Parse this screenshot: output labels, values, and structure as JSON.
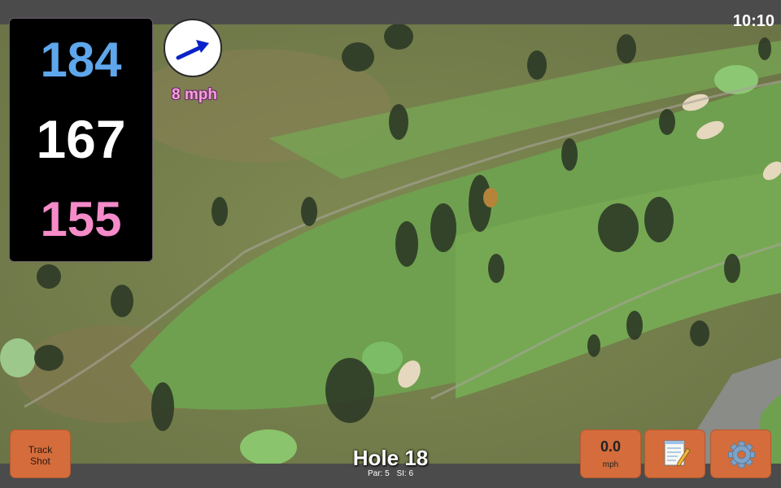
{
  "status": {
    "time": "10:10"
  },
  "distances": {
    "back": "184",
    "middle": "167",
    "front": "155"
  },
  "wind": {
    "speed_label": "8 mph",
    "direction_icon": "arrow-icon"
  },
  "buttons": {
    "track_shot_line1": "Track",
    "track_shot_line2": "Shot",
    "speed_value": "0.0",
    "speed_unit": "mph",
    "notes_icon": "notepad-icon",
    "settings_icon": "gear-icon"
  },
  "hole": {
    "title": "Hole 18",
    "par": "Par: 5",
    "si": "SI: 6"
  },
  "colors": {
    "back": "#5fa7ec",
    "middle": "#ffffff",
    "front": "#f58bc8",
    "button": "#d46c3c"
  }
}
